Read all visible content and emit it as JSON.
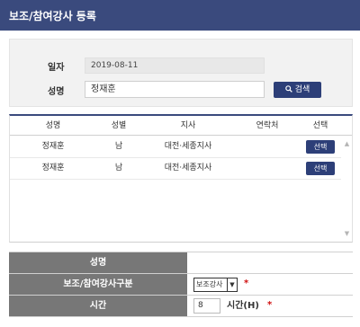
{
  "header": {
    "title": "보조/참여강사 등록"
  },
  "search": {
    "date_label": "일자",
    "date_value": "2019-08-11",
    "name_label": "성명",
    "name_value": "정재훈",
    "search_button": "검색",
    "search_icon": "search-icon"
  },
  "grid": {
    "columns": [
      "성명",
      "성별",
      "지사",
      "연락처",
      "선택"
    ],
    "rows": [
      {
        "name": "정재훈",
        "gender": "남",
        "branch": "대전·세종지사",
        "contact": "",
        "select": "선택"
      },
      {
        "name": "정재훈",
        "gender": "남",
        "branch": "대전·세종지사",
        "contact": "",
        "select": "선택"
      }
    ],
    "scroll_up_icon": "chevron-up-icon",
    "scroll_down_icon": "chevron-down-icon"
  },
  "form": {
    "name_label": "성명",
    "name_value": "",
    "type_label": "보조/참여강사구분",
    "type_value": "보조강사",
    "hours_label": "시간",
    "hours_value": "8",
    "hours_unit": "시간(H)",
    "required_mark": "*"
  },
  "colors": {
    "header": "#3a4a7d",
    "button": "#2d3f78",
    "label_bg": "#777777",
    "required": "#d01010"
  }
}
